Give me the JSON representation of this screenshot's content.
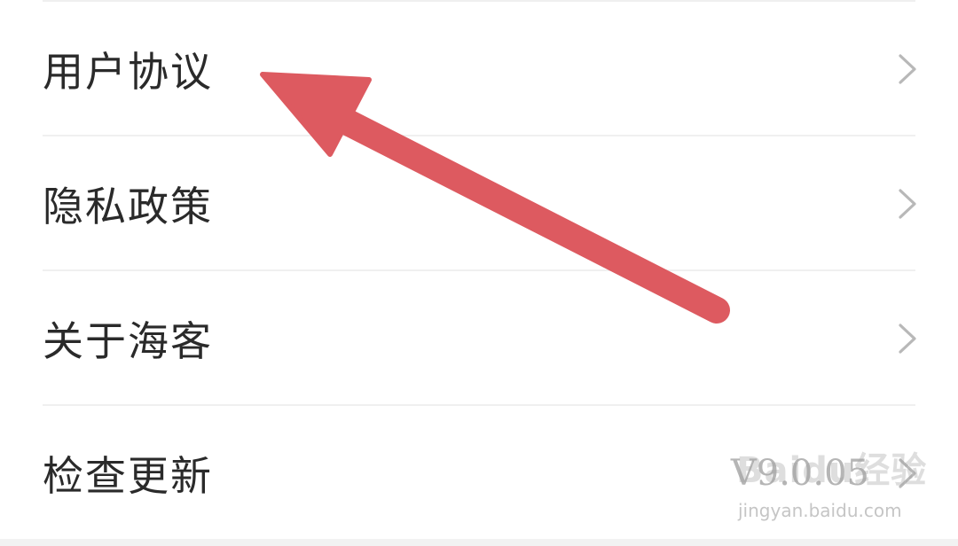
{
  "settings": {
    "items": [
      {
        "label": "用户协议",
        "value": ""
      },
      {
        "label": "隐私政策",
        "value": ""
      },
      {
        "label": "关于海客",
        "value": ""
      },
      {
        "label": "检查更新",
        "value": "V9.0.05"
      }
    ]
  },
  "annotation": {
    "arrow_color": "#dd5a60"
  },
  "watermark": {
    "logo_text": "Baidu经验",
    "url": "jingyan.baidu.com"
  },
  "colors": {
    "text": "#2a2a2a",
    "value_text": "#b5b5b5",
    "chevron": "#b8b8b8",
    "divider": "#f0f0f0"
  }
}
